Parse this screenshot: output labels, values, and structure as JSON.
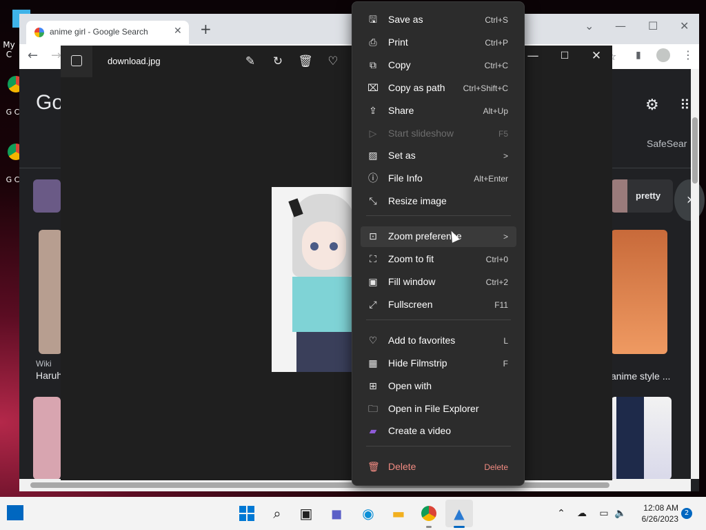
{
  "desktop": {
    "icons": [
      {
        "label": "My C",
        "icon": "computer-icon"
      },
      {
        "label": "G Cl",
        "icon": "chrome-shortcut-icon"
      },
      {
        "label": "G Cl",
        "icon": "chrome-shortcut-icon"
      }
    ]
  },
  "chrome": {
    "tab_title": "anime girl - Google Search",
    "new_tab": "+",
    "google_partial": "Go",
    "safesearch": "SafeSear",
    "chip_label": "pretty",
    "result_labels": [
      "Wiki",
      "Haruh",
      "anime style ..."
    ],
    "accent": "#dee1e6"
  },
  "photos": {
    "file_name": "download.jpg",
    "toolbar": [
      "edit-image-icon",
      "rotate-icon",
      "delete-icon",
      "favorite-icon"
    ],
    "window_controls": [
      "minimize",
      "maximize",
      "close"
    ]
  },
  "context_menu": {
    "items": [
      {
        "label": "Save as",
        "shortcut": "Ctrl+S",
        "icon": "save-icon"
      },
      {
        "label": "Print",
        "shortcut": "Ctrl+P",
        "icon": "print-icon"
      },
      {
        "label": "Copy",
        "shortcut": "Ctrl+C",
        "icon": "copy-icon"
      },
      {
        "label": "Copy as path",
        "shortcut": "Ctrl+Shift+C",
        "icon": "copy-path-icon"
      },
      {
        "label": "Share",
        "shortcut": "Alt+Up",
        "icon": "share-icon"
      },
      {
        "label": "Start slideshow",
        "shortcut": "F5",
        "icon": "slideshow-icon",
        "disabled": true
      },
      {
        "label": "Set as",
        "shortcut": ">",
        "icon": "set-as-icon"
      },
      {
        "label": "File Info",
        "shortcut": "Alt+Enter",
        "icon": "info-icon"
      },
      {
        "label": "Resize image",
        "shortcut": "",
        "icon": "resize-icon"
      },
      {
        "label": "Zoom preference",
        "shortcut": ">",
        "icon": "zoom-icon",
        "hover": true
      },
      {
        "label": "Zoom to fit",
        "shortcut": "Ctrl+0",
        "icon": "zoom-fit-icon"
      },
      {
        "label": "Fill window",
        "shortcut": "Ctrl+2",
        "icon": "fill-window-icon"
      },
      {
        "label": "Fullscreen",
        "shortcut": "F11",
        "icon": "fullscreen-icon"
      },
      {
        "label": "Add to favorites",
        "shortcut": "L",
        "icon": "heart-icon"
      },
      {
        "label": "Hide Filmstrip",
        "shortcut": "F",
        "icon": "filmstrip-icon"
      },
      {
        "label": "Open with",
        "shortcut": "",
        "icon": "open-with-icon"
      },
      {
        "label": "Open in File Explorer",
        "shortcut": "",
        "icon": "folder-icon"
      },
      {
        "label": "Create a video",
        "shortcut": "",
        "icon": "video-icon"
      },
      {
        "label": "Delete",
        "shortcut": "Delete",
        "icon": "trash-icon",
        "danger": true
      }
    ]
  },
  "taskbar": {
    "time": "12:08 AM",
    "date": "6/26/2023",
    "notifications": "2"
  }
}
